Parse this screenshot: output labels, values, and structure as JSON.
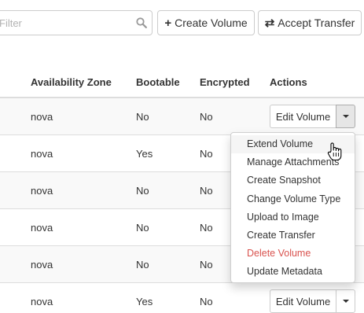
{
  "toolbar": {
    "filter_placeholder": "Filter",
    "search_icon": "magnifier-icon",
    "create_volume": {
      "icon": "plus-icon",
      "glyph": "+",
      "label": "Create Volume"
    },
    "accept_transfer": {
      "icon": "exchange-icon",
      "glyph": "⇄",
      "label": "Accept Transfer"
    }
  },
  "table": {
    "headers": [
      "Availability Zone",
      "Bootable",
      "Encrypted",
      "Actions"
    ],
    "rows": [
      {
        "az": "nova",
        "bootable": "No",
        "encrypted": "No",
        "action": "Edit Volume"
      },
      {
        "az": "nova",
        "bootable": "Yes",
        "encrypted": "No",
        "action": ""
      },
      {
        "az": "nova",
        "bootable": "No",
        "encrypted": "No",
        "action": ""
      },
      {
        "az": "nova",
        "bootable": "No",
        "encrypted": "No",
        "action": ""
      },
      {
        "az": "nova",
        "bootable": "No",
        "encrypted": "No",
        "action": ""
      },
      {
        "az": "nova",
        "bootable": "Yes",
        "encrypted": "No",
        "action": "Edit Volume"
      }
    ]
  },
  "dropdown": {
    "items": [
      "Extend Volume",
      "Manage Attachments",
      "Create Snapshot",
      "Change Volume Type",
      "Upload to Image",
      "Create Transfer",
      "Delete Volume",
      "Update Metadata"
    ],
    "danger_color": "#d9534f"
  },
  "cursor": "hand-pointer-icon"
}
